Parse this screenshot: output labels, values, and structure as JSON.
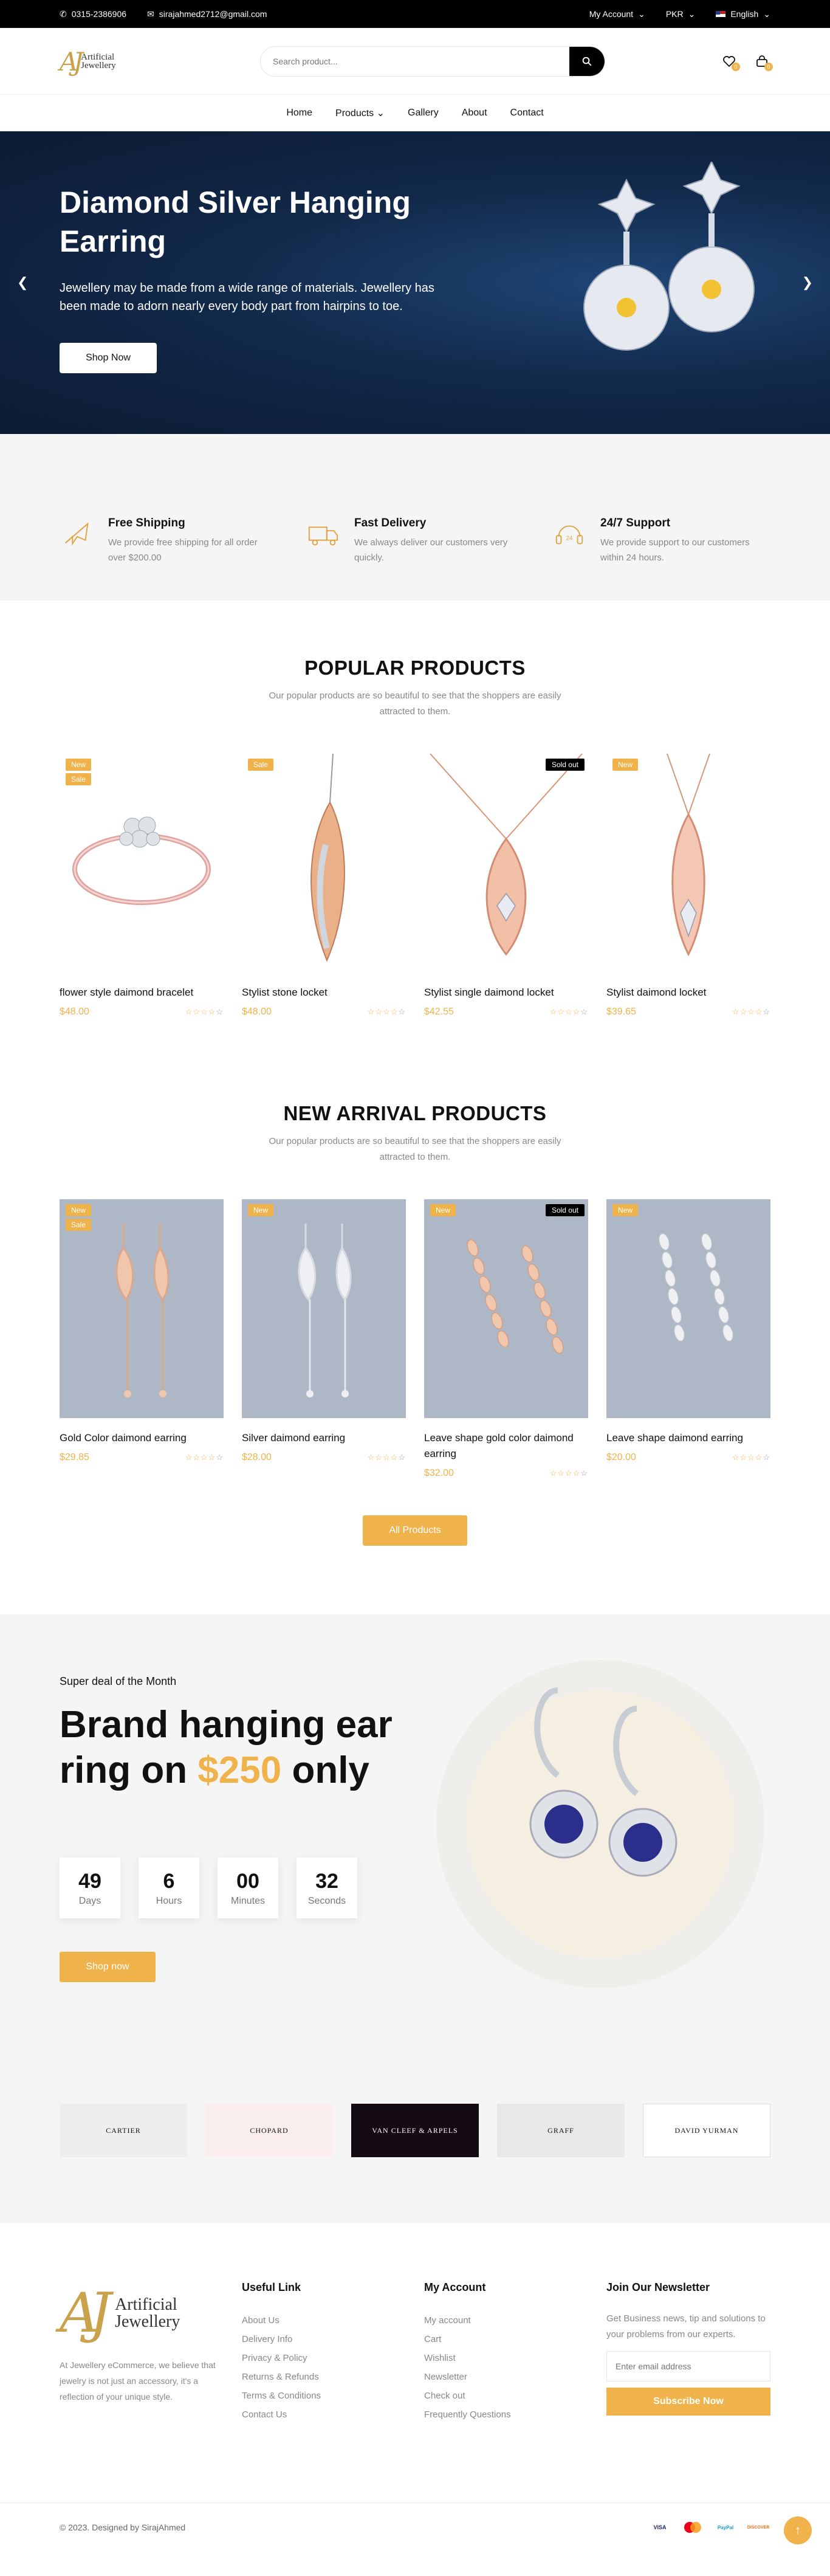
{
  "topbar": {
    "phone": "0315-2386906",
    "email": "sirajahmed2712@gmail.com",
    "account": "My Account",
    "currency": "PKR",
    "language": "English"
  },
  "header": {
    "logo_line1": "Artificial",
    "logo_line2": "Jewellery",
    "search_placeholder": "Search product...",
    "wishlist_count": "0",
    "cart_count": "0"
  },
  "nav": [
    "Home",
    "Products",
    "Gallery",
    "About",
    "Contact"
  ],
  "hero": {
    "title": "Diamond Silver Hanging Earring",
    "text": "Jewellery may be made from a wide range of materials. Jewellery has been made to adorn nearly every body part from hairpins to toe.",
    "button": "Shop Now"
  },
  "features": [
    {
      "icon": "plane-icon",
      "title": "Free Shipping",
      "text": "We provide free shipping for all order over $200.00"
    },
    {
      "icon": "truck-icon",
      "title": "Fast Delivery",
      "text": "We always deliver our customers very quickly."
    },
    {
      "icon": "headset-icon",
      "title": "24/7 Support",
      "text": "We provide support to our customers within 24 hours."
    }
  ],
  "popular": {
    "title": "POPULAR PRODUCTS",
    "subtitle": "Our popular products are so beautiful to see that the shoppers are easily attracted to them.",
    "products": [
      {
        "name": "flower style daimond bracelet",
        "price": "$48.00",
        "badges": [
          "New",
          "Sale"
        ],
        "sold_out": ""
      },
      {
        "name": "Stylist stone locket",
        "price": "$48.00",
        "badges": [
          "Sale"
        ],
        "sold_out": ""
      },
      {
        "name": "Stylist single daimond locket",
        "price": "$42.55",
        "badges": [],
        "sold_out": "Sold out"
      },
      {
        "name": "Stylist daimond locket",
        "price": "$39.65",
        "badges": [
          "New"
        ],
        "sold_out": ""
      }
    ]
  },
  "arrivals": {
    "title": "NEW ARRIVAL PRODUCTS",
    "subtitle": "Our popular products are so beautiful to see that the shoppers are easily attracted to them.",
    "products": [
      {
        "name": "Gold Color daimond earring",
        "price": "$29.85",
        "badges": [
          "New",
          "Sale"
        ],
        "sold_out": ""
      },
      {
        "name": "Silver daimond earring",
        "price": "$28.00",
        "badges": [
          "New"
        ],
        "sold_out": ""
      },
      {
        "name": "Leave shape gold color daimond earring",
        "price": "$32.00",
        "badges": [
          "New"
        ],
        "sold_out": "Sold out"
      },
      {
        "name": "Leave shape daimond earring",
        "price": "$20.00",
        "badges": [
          "New"
        ],
        "sold_out": ""
      }
    ],
    "button": "All Products"
  },
  "deal": {
    "kicker": "Super deal of the Month",
    "title_before": "Brand hanging ear ring on ",
    "title_amount": "$250",
    "title_after": " only",
    "countdown": [
      {
        "value": "49",
        "label": "Days"
      },
      {
        "value": "6",
        "label": "Hours"
      },
      {
        "value": "00",
        "label": "Minutes"
      },
      {
        "value": "32",
        "label": "Seconds"
      }
    ],
    "button": "Shop now"
  },
  "brands": [
    "CARTIER",
    "CHOPARD",
    "VAN CLEEF & ARPELS",
    "GRAFF",
    "DAVID YURMAN"
  ],
  "footer": {
    "about": "At Jewellery eCommerce, we believe that jewelry is not just an accessory, it's a reflection of your unique style.",
    "useful_title": "Useful Link",
    "useful_links": [
      "About Us",
      "Delivery Info",
      "Privacy & Policy",
      "Returns & Refunds",
      "Terms & Conditions",
      "Contact Us"
    ],
    "account_title": "My Account",
    "account_links": [
      "My account",
      "Cart",
      "Wishlist",
      "Newsletter",
      "Check out",
      "Frequently Questions"
    ],
    "newsletter_title": "Join Our Newsletter",
    "newsletter_text": "Get Business news, tip and solutions to your problems from our experts.",
    "newsletter_placeholder": "Enter email address",
    "newsletter_button": "Subscribe Now",
    "copyright": "© 2023. Designed by SirajAhmed",
    "payments": [
      "VISA",
      "Mastercard",
      "PayPal",
      "DISCOVER"
    ]
  },
  "colors": {
    "accent": "#f0b24a",
    "dark": "#000000",
    "hero_bg": "#12294a"
  }
}
